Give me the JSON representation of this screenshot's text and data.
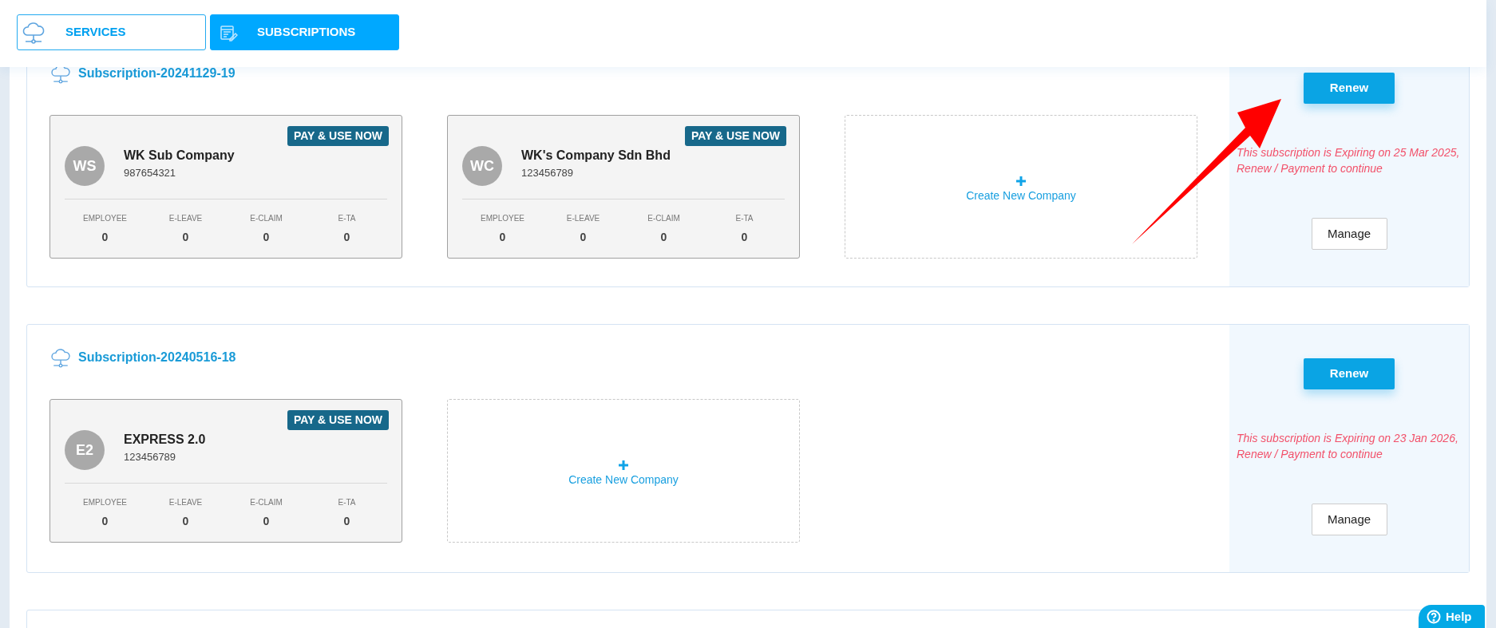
{
  "tabs": [
    {
      "label": "SERVICES",
      "selected": false
    },
    {
      "label": "SUBSCRIPTIONS",
      "selected": true
    }
  ],
  "subscriptions": [
    {
      "title": "Subscription-20241129-19",
      "companies": [
        {
          "initials": "WS",
          "name": "WK Sub Company",
          "number": "987654321",
          "badge": "PAY & USE NOW",
          "stats": [
            {
              "label": "EMPLOYEE",
              "value": "0"
            },
            {
              "label": "E-LEAVE",
              "value": "0"
            },
            {
              "label": "E-CLAIM",
              "value": "0"
            },
            {
              "label": "E-TA",
              "value": "0"
            }
          ]
        },
        {
          "initials": "WC",
          "name": "WK's Company Sdn Bhd",
          "number": "123456789",
          "badge": "PAY & USE NOW",
          "stats": [
            {
              "label": "EMPLOYEE",
              "value": "0"
            },
            {
              "label": "E-LEAVE",
              "value": "0"
            },
            {
              "label": "E-CLAIM",
              "value": "0"
            },
            {
              "label": "E-TA",
              "value": "0"
            }
          ]
        }
      ],
      "create_label": "Create New Company",
      "renew": "Renew",
      "message": "This subscription is Expiring on 25 Mar 2025, Renew / Payment to continue",
      "manage": "Manage"
    },
    {
      "title": "Subscription-20240516-18",
      "companies": [
        {
          "initials": "E2",
          "name": "EXPRESS 2.0",
          "number": "123456789",
          "badge": "PAY & USE NOW",
          "stats": [
            {
              "label": "EMPLOYEE",
              "value": "0"
            },
            {
              "label": "E-LEAVE",
              "value": "0"
            },
            {
              "label": "E-CLAIM",
              "value": "0"
            },
            {
              "label": "E-TA",
              "value": "0"
            }
          ]
        }
      ],
      "create_label": "Create New Company",
      "renew": "Renew",
      "message": "This subscription is Expiring on 23 Jan 2026, Renew / Payment to continue",
      "manage": "Manage"
    }
  ],
  "annotation": {
    "kind": "arrow"
  },
  "help": {
    "label": "Help"
  }
}
